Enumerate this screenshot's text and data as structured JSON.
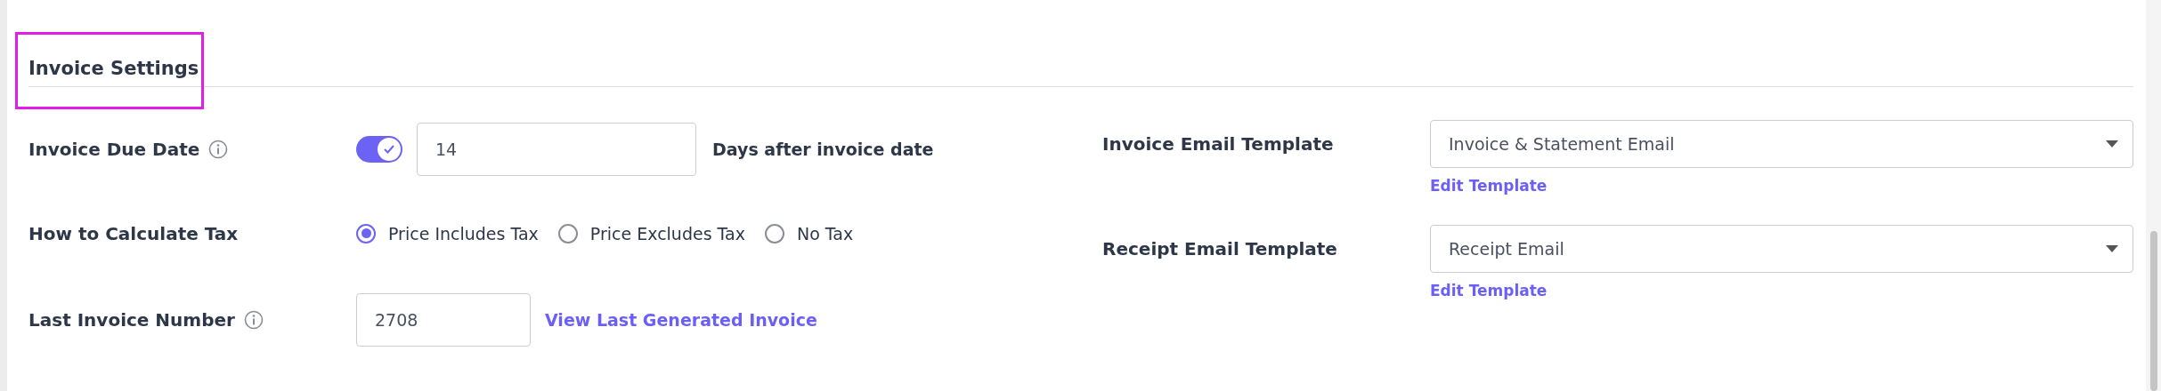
{
  "section": {
    "title": "Invoice Settings",
    "highlighted": true
  },
  "left_fields": [
    {
      "kind": "toggle_input",
      "label": "Invoice Due Date",
      "info": true,
      "toggle_on": true,
      "value": "14",
      "suffix": "Days after invoice date"
    },
    {
      "kind": "radio",
      "label": "How to Calculate Tax",
      "options": [
        {
          "label": "Price Includes Tax",
          "selected": true
        },
        {
          "label": "Price Excludes Tax",
          "selected": false
        },
        {
          "label": "No Tax",
          "selected": false
        }
      ]
    },
    {
      "kind": "input_link",
      "label": "Last Invoice Number",
      "info": true,
      "value": "2708",
      "link": "View Last Generated Invoice"
    }
  ],
  "right_fields": [
    {
      "label": "Invoice Email Template",
      "value": "Invoice & Statement Email",
      "link": "Edit Template"
    },
    {
      "label": "Receipt Email Template",
      "value": "Receipt Email",
      "link": "Edit Template"
    }
  ]
}
